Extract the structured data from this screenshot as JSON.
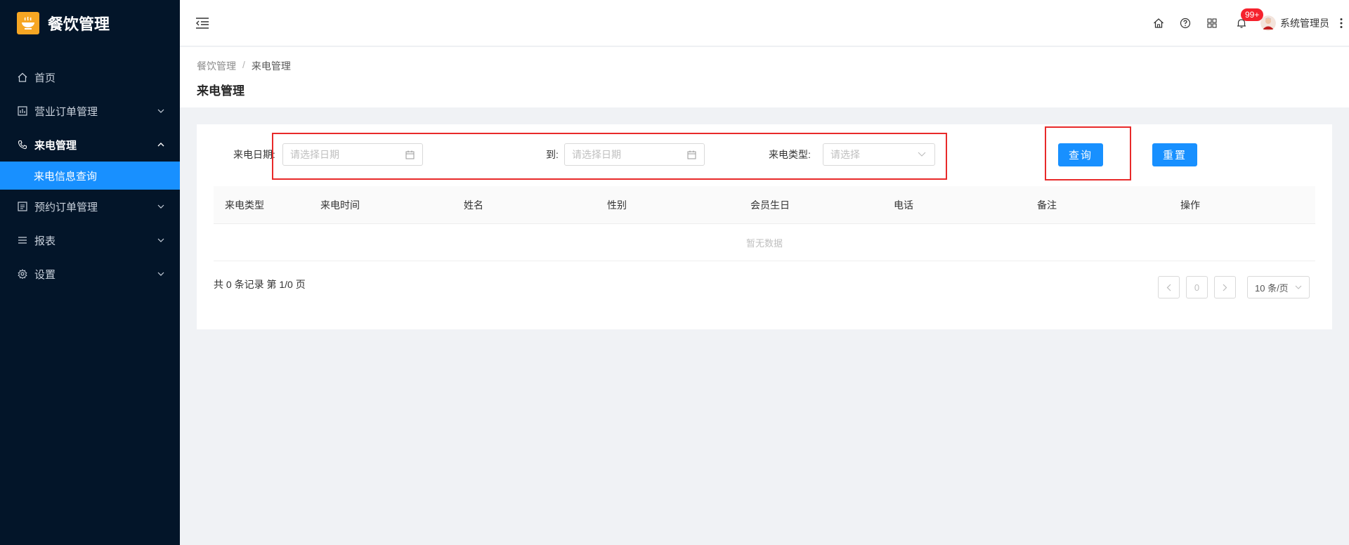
{
  "app": {
    "title": "餐饮管理"
  },
  "sidebar": {
    "items": [
      {
        "label": "首页",
        "icon": "home-icon"
      },
      {
        "label": "营业订单管理",
        "icon": "chart-icon"
      },
      {
        "label": "来电管理",
        "icon": "phone-icon",
        "open": true,
        "children": [
          {
            "label": "来电信息查询",
            "active": true
          }
        ]
      },
      {
        "label": "预约订单管理",
        "icon": "list-icon"
      },
      {
        "label": "报表",
        "icon": "menu-lines-icon"
      },
      {
        "label": "设置",
        "icon": "gear-icon"
      }
    ]
  },
  "header": {
    "notification_badge": "99+",
    "user_name": "系统管理员"
  },
  "breadcrumb": {
    "root": "餐饮管理",
    "separator": "/",
    "current": "来电管理"
  },
  "page_title": "来电管理",
  "filters": {
    "date_label": "来电日期:",
    "date_start_placeholder": "请选择日期",
    "to_label": "到:",
    "date_end_placeholder": "请选择日期",
    "type_label": "来电类型:",
    "type_placeholder": "请选择",
    "query_button": "查询",
    "reset_button": "重置"
  },
  "table": {
    "columns": [
      "来电类型",
      "来电时间",
      "姓名",
      "性别",
      "会员生日",
      "电话",
      "备注",
      "操作"
    ],
    "empty_text": "暂无数据"
  },
  "pagination": {
    "total_text": "共 0 条记录 第 1/0 页",
    "current_page": "0",
    "page_size": "10 条/页"
  },
  "colors": {
    "sidebar_bg": "#031529",
    "primary": "#1890ff",
    "logo": "#f6a623",
    "highlight_box": "#e82a2a",
    "badge": "#f5222d"
  }
}
